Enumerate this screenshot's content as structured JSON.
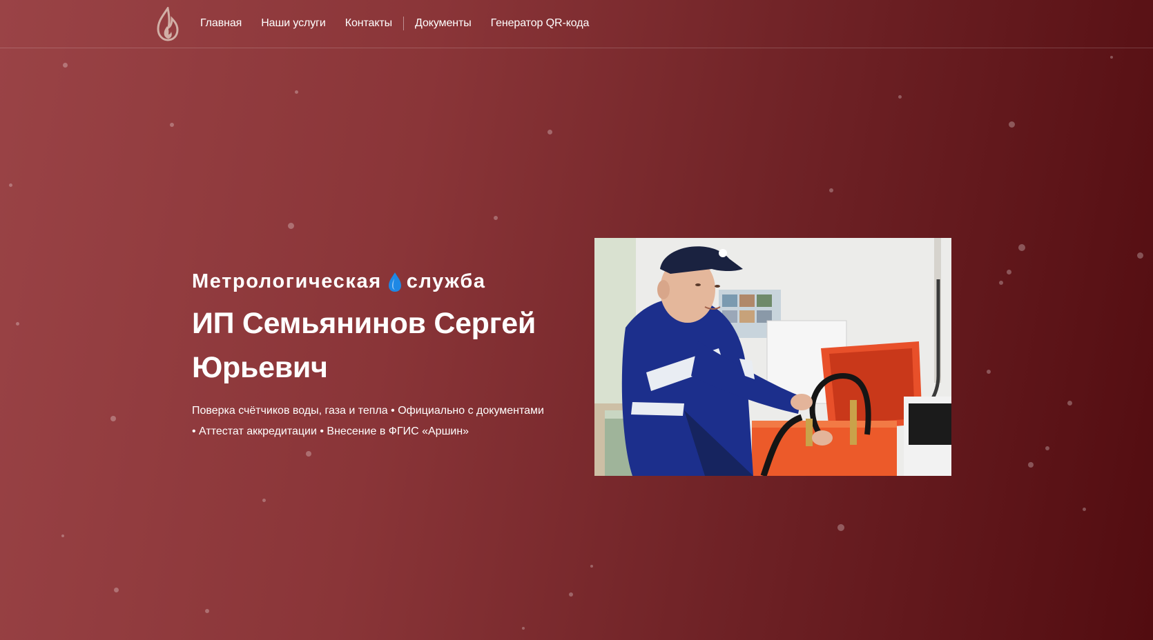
{
  "header": {
    "logo_icon": "flame-icon",
    "nav": [
      {
        "label": "Главная"
      },
      {
        "label": "Наши услуги"
      },
      {
        "label": "Контакты"
      },
      {
        "label": "Документы"
      },
      {
        "label": "Генератор QR-кода"
      }
    ]
  },
  "hero": {
    "service_prefix": "Метрологическая",
    "service_icon": "water-drop-icon",
    "service_suffix": "служба",
    "name": "ИП Семьянинов Сергей Юрьевич",
    "subtitle_line1": "Поверка счётчиков воды, газа и тепла • Официально с документами",
    "subtitle_line2": "• Аттестат аккредитации • Внесение в ФГИС «Аршин»",
    "photo_icon": "technician-photo"
  },
  "colors": {
    "background_start": "#9a4346",
    "background_end": "#520c10",
    "accent_drop": "#1e88e5",
    "case_orange": "#e8502a"
  }
}
